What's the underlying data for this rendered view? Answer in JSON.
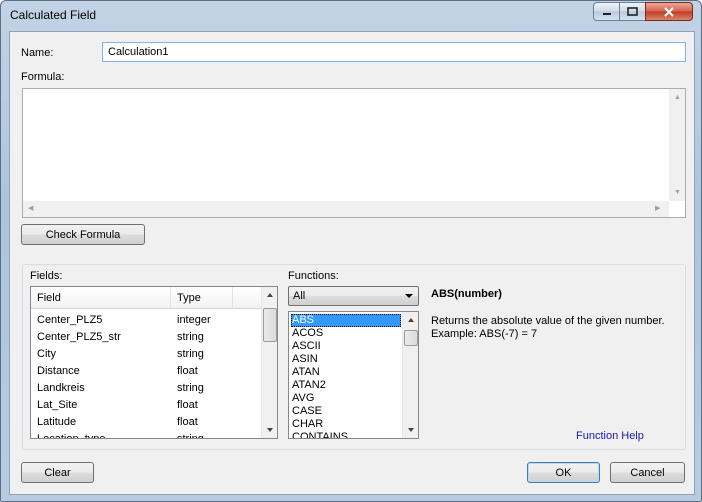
{
  "window": {
    "title": "Calculated Field"
  },
  "name_label": "Name:",
  "name_value": "Calculation1",
  "formula_label": "Formula:",
  "check_formula_button": "Check Formula",
  "fields_label": "Fields:",
  "fields_table": {
    "columns": [
      "Field",
      "Type"
    ],
    "rows": [
      {
        "field": "Center_PLZ5",
        "type": "integer"
      },
      {
        "field": "Center_PLZ5_str",
        "type": "string"
      },
      {
        "field": "City",
        "type": "string"
      },
      {
        "field": "Distance",
        "type": "float"
      },
      {
        "field": "Landkreis",
        "type": "string"
      },
      {
        "field": "Lat_Site",
        "type": "float"
      },
      {
        "field": "Latitude",
        "type": "float"
      },
      {
        "field": "Location_type",
        "type": "string"
      }
    ]
  },
  "functions_label": "Functions:",
  "functions_filter": "All",
  "functions_list": [
    "ABS",
    "ACOS",
    "ASCII",
    "ASIN",
    "ATAN",
    "ATAN2",
    "AVG",
    "CASE",
    "CHAR",
    "CONTAINS"
  ],
  "selected_function": "ABS",
  "function_signature": "ABS(number)",
  "function_description": "Returns the absolute value of the given number.\nExample: ABS(-7) = 7",
  "function_help_link": "Function Help",
  "clear_button": "Clear",
  "ok_button": "OK",
  "cancel_button": "Cancel",
  "icons": [
    "minimize-icon",
    "maximize-icon",
    "close-icon",
    "chevron-down-icon",
    "scroll-up-icon",
    "scroll-down-icon"
  ]
}
